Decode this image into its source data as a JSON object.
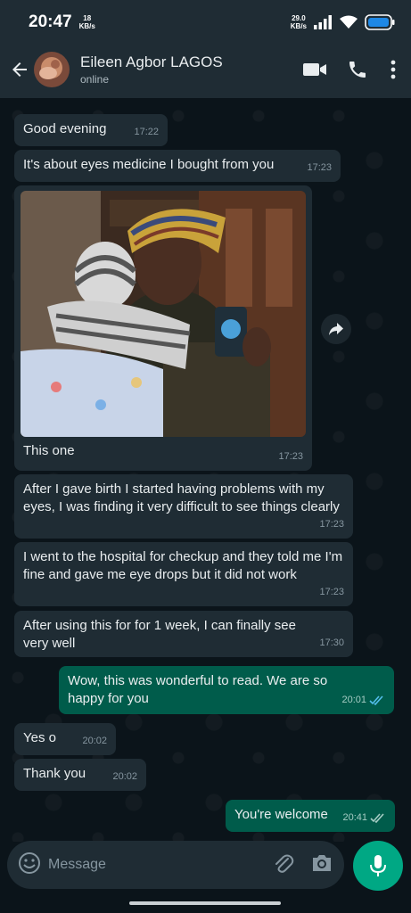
{
  "status_bar": {
    "time": "20:47",
    "speed_left_value": "18",
    "speed_left_unit": "KB/s",
    "speed_right_value": "29.0",
    "speed_right_unit": "KB/s"
  },
  "header": {
    "contact_name": "Eileen Agbor LAGOS",
    "contact_status": "online"
  },
  "messages": [
    {
      "direction": "in",
      "text": "Good evening",
      "time": "17:22"
    },
    {
      "direction": "in",
      "text": "It's about eyes medicine I bought from you",
      "time": "17:23"
    },
    {
      "direction": "in",
      "type": "image",
      "caption": "This one",
      "time": "17:23"
    },
    {
      "direction": "in",
      "text": "After I gave birth I started having problems with my eyes, I was finding it very difficult to see things clearly",
      "time": "17:23"
    },
    {
      "direction": "in",
      "text": "I went to the hospital for checkup and they told me I'm fine and gave me eye drops but it did not work",
      "time": "17:23"
    },
    {
      "direction": "in",
      "text": "After using this for for 1 week, I can finally see very well",
      "time": "17:30"
    },
    {
      "direction": "out",
      "text": "Wow, this was wonderful to read. We are so happy for you",
      "time": "20:01",
      "status": "read"
    },
    {
      "direction": "in",
      "text": "Yes o",
      "time": "20:02"
    },
    {
      "direction": "in",
      "text": "Thank you",
      "time": "20:02"
    },
    {
      "direction": "out",
      "text": "You're welcome",
      "time": "20:41",
      "status": "delivered"
    }
  ],
  "composer": {
    "placeholder": "Message"
  },
  "icons": {
    "back": "arrow-left-icon",
    "video": "video-call-icon",
    "call": "phone-icon",
    "menu": "more-vertical-icon",
    "emoji": "emoji-icon",
    "attach": "paperclip-icon",
    "camera": "camera-icon",
    "mic": "microphone-icon",
    "forward": "forward-icon"
  },
  "colors": {
    "incoming_bubble": "#1f2c34",
    "outgoing_bubble": "#005c4b",
    "accent": "#00a884",
    "read_tick": "#53bdeb"
  }
}
